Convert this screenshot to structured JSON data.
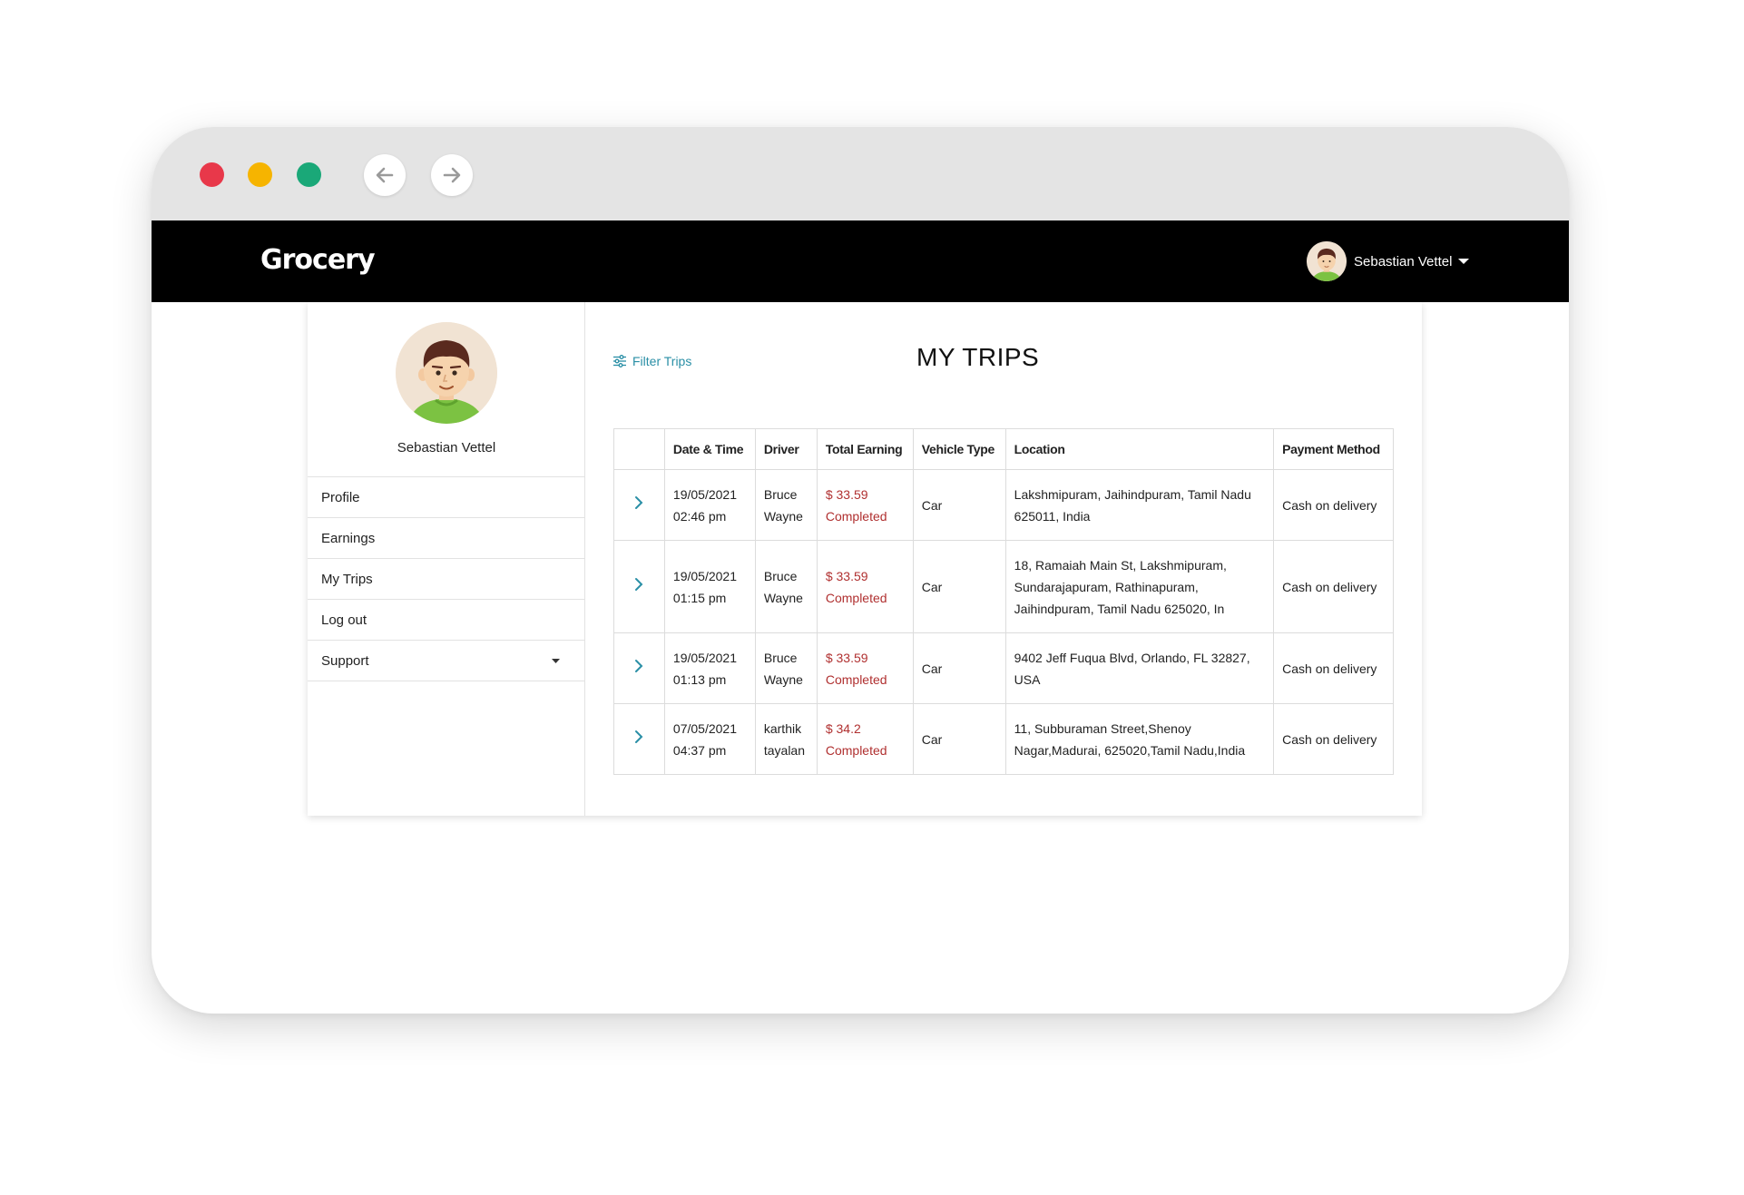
{
  "browser": {
    "controls": {
      "close_color": "#e8384a",
      "minimize_color": "#f6b400",
      "maximize_color": "#1aa878"
    },
    "back_icon": "arrow-left-icon",
    "forward_icon": "arrow-right-icon"
  },
  "header": {
    "logo_text": "Grocery",
    "user_name": "Sebastian Vettel"
  },
  "sidebar": {
    "profile_name": "Sebastian Vettel",
    "items": [
      {
        "label": "Profile"
      },
      {
        "label": "Earnings"
      },
      {
        "label": "My Trips"
      },
      {
        "label": "Log out"
      },
      {
        "label": "Support"
      }
    ]
  },
  "main": {
    "filter_label": "Filter Trips",
    "title": "MY TRIPS"
  },
  "table": {
    "columns": [
      "",
      "Date & Time",
      "Driver",
      "Total Earning",
      "Vehicle Type",
      "Location",
      "Payment Method"
    ],
    "rows": [
      {
        "date": "19/05/2021",
        "time": "02:46 pm",
        "driver_first": "Bruce",
        "driver_last": "Wayne",
        "amount": "$ 33.59",
        "status": "Completed",
        "vehicle": "Car",
        "location": "Lakshmipuram, Jaihindpuram, Tamil Nadu 625011, India",
        "payment": "Cash on delivery"
      },
      {
        "date": "19/05/2021",
        "time": "01:15 pm",
        "driver_first": "Bruce",
        "driver_last": "Wayne",
        "amount": "$ 33.59",
        "status": "Completed",
        "vehicle": "Car",
        "location": "18, Ramaiah Main St, Lakshmipuram, Sundarajapuram, Rathinapuram, Jaihindpuram, Tamil Nadu 625020, In",
        "payment": "Cash on delivery"
      },
      {
        "date": "19/05/2021",
        "time": "01:13 pm",
        "driver_first": "Bruce",
        "driver_last": "Wayne",
        "amount": "$ 33.59",
        "status": "Completed",
        "vehicle": "Car",
        "location": "9402 Jeff Fuqua Blvd, Orlando, FL 32827, USA",
        "payment": "Cash on delivery"
      },
      {
        "date": "07/05/2021",
        "time": "04:37 pm",
        "driver_first": "karthik",
        "driver_last": "tayalan",
        "amount": "$ 34.2",
        "status": "Completed",
        "vehicle": "Car",
        "location": "11, Subburaman Street,Shenoy Nagar,Madurai, 625020,Tamil Nadu,India",
        "payment": "Cash on delivery"
      }
    ]
  },
  "colors": {
    "accent": "#2a8fa6",
    "earning": "#b03030",
    "header_bg": "#000000",
    "chrome_bg": "#e4e4e4"
  }
}
